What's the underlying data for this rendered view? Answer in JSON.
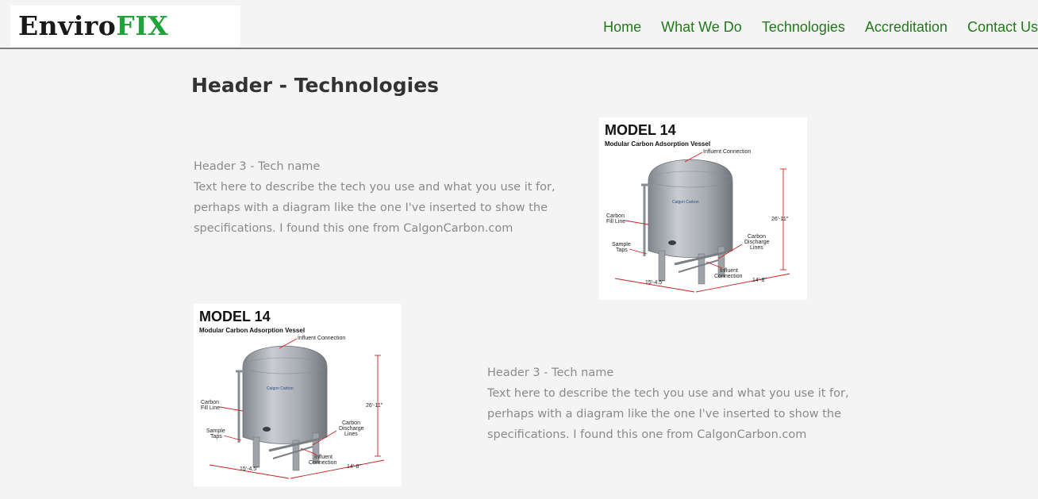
{
  "logo": {
    "part1": "Enviro",
    "part2": "FIX"
  },
  "nav": [
    {
      "label": "Home"
    },
    {
      "label": "What We Do"
    },
    {
      "label": "Technologies"
    },
    {
      "label": "Accreditation"
    },
    {
      "label": "Contact Us"
    }
  ],
  "page": {
    "title": "Header - Technologies"
  },
  "techs": [
    {
      "name": "Header 3 - Tech name",
      "lines": [
        "Text here to describe the tech you use and what you use it for,",
        "perhaps with a diagram like the one I've inserted to show the",
        "specifications. I found this one from CalgonCarbon.com"
      ]
    },
    {
      "name": "Header 3 - Tech name",
      "lines": [
        "Text here to describe the tech you use and what you use it for,",
        "perhaps with a diagram like the one I've inserted to show the",
        "specifications. I found this one from CalgonCarbon.com"
      ]
    }
  ],
  "diagram": {
    "model": "MODEL 14",
    "subtitle": "Modular Carbon Adsorption Vessel",
    "labels": {
      "influent_top": "Influent Connection",
      "height": "26'-11\"",
      "carbon_fill_1": "Carbon",
      "carbon_fill_2": "Fill Line",
      "sample_1": "Sample",
      "sample_2": "Taps",
      "discharge_1": "Carbon",
      "discharge_2": "Discharge",
      "discharge_3": "Lines",
      "influent_bottom_1": "Influent",
      "influent_bottom_2": "Connection",
      "width": "15'-4.5\"",
      "depth": "14'-8\""
    },
    "colors": {
      "dimension": "#cc2222",
      "tank": "#9ea3a8"
    }
  }
}
